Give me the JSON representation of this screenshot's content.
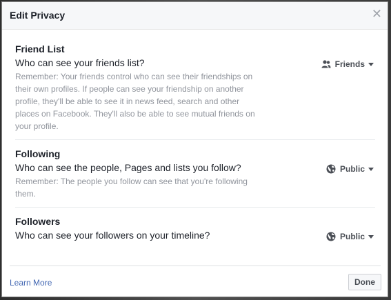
{
  "dialog": {
    "title": "Edit Privacy",
    "close_icon": "close-icon"
  },
  "sections": [
    {
      "heading": "Friend List",
      "question": "Who can see your friends list?",
      "note": "Remember: Your friends control who can see their friendships on their own profiles. If people can see your friendship on another profile, they'll be able to see it in news feed, search and other places on Facebook. They'll also be able to see mutual friends on your profile.",
      "audience": "Friends",
      "audience_icon": "friends-icon"
    },
    {
      "heading": "Following",
      "question": "Who can see the people, Pages and lists you follow?",
      "note": "Remember: The people you follow can see that you're following them.",
      "audience": "Public",
      "audience_icon": "globe-icon"
    },
    {
      "heading": "Followers",
      "question": "Who can see your followers on your timeline?",
      "note": "",
      "audience": "Public",
      "audience_icon": "globe-icon"
    }
  ],
  "footer": {
    "learn_more": "Learn More",
    "done": "Done"
  },
  "colors": {
    "link": "#4267b2",
    "text": "#1d2129",
    "muted": "#90949c"
  }
}
